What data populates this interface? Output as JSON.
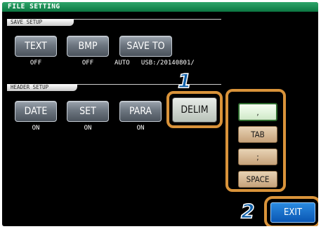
{
  "title": "FILE SETTING",
  "save_setup": {
    "label": "SAVE SETUP",
    "buttons": [
      {
        "label": "TEXT",
        "value": "OFF"
      },
      {
        "label": "BMP",
        "value": "OFF"
      },
      {
        "label": "SAVE TO",
        "value": "AUTO   USB:/20140801/"
      }
    ]
  },
  "header_setup": {
    "label": "HEADER SETUP",
    "buttons": [
      {
        "label": "DATE",
        "value": "ON"
      },
      {
        "label": "SET",
        "value": "ON"
      },
      {
        "label": "PARA",
        "value": "ON"
      },
      {
        "label": "DELIM"
      }
    ]
  },
  "delimiter_options": [
    {
      "label": ",",
      "selected": true
    },
    {
      "label": "TAB",
      "selected": false
    },
    {
      "label": ";",
      "selected": false
    },
    {
      "label": "SPACE",
      "selected": false
    }
  ],
  "exit_label": "EXIT",
  "callouts": [
    "1",
    "2"
  ],
  "colors": {
    "highlight": "#d9933a",
    "title_bar": "#0d7a44",
    "exit_button": "#0a56b3",
    "callout_number": "#0f5fa8"
  }
}
